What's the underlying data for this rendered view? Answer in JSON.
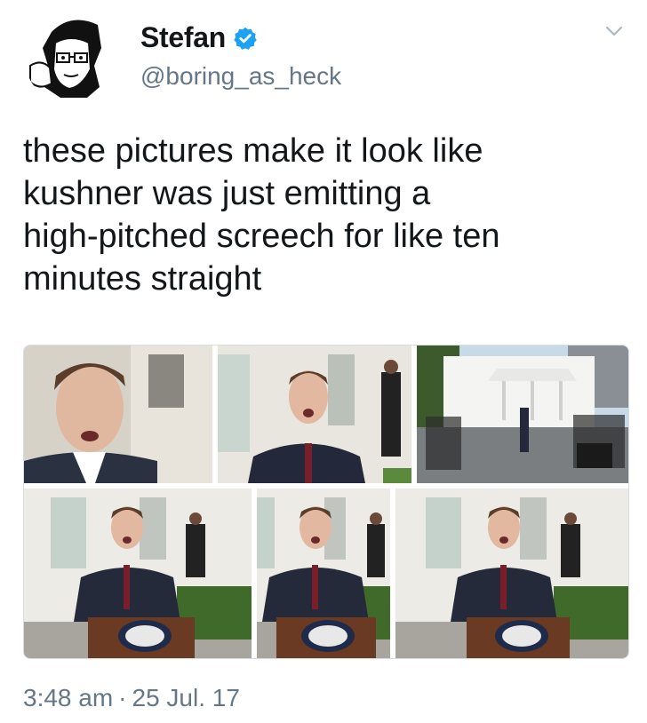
{
  "author": {
    "name": "Stefan",
    "handle": "@boring_as_heck",
    "verified": true,
    "avatar_icon": "cartoon-avatar-icon"
  },
  "tweet": {
    "text": "these pictures make it look like\nkushner was just emitting a\nhigh-pitched screech for like ten\nminutes straight"
  },
  "media": {
    "photo_count": 6,
    "photos": [
      {
        "description_icon": "speaker-closeup-photo"
      },
      {
        "description_icon": "speaker-medium-photo"
      },
      {
        "description_icon": "white-house-exterior-photo"
      },
      {
        "description_icon": "speaker-podium-photo"
      },
      {
        "description_icon": "speaker-podium-photo"
      },
      {
        "description_icon": "speaker-podium-photo"
      }
    ]
  },
  "meta": {
    "time": "3:48 am",
    "separator": "·",
    "date": "25 Jul. 17"
  },
  "colors": {
    "text": "#14171a",
    "secondary": "#657786",
    "verified_blue": "#1da1f2",
    "border": "#d8dde2"
  }
}
